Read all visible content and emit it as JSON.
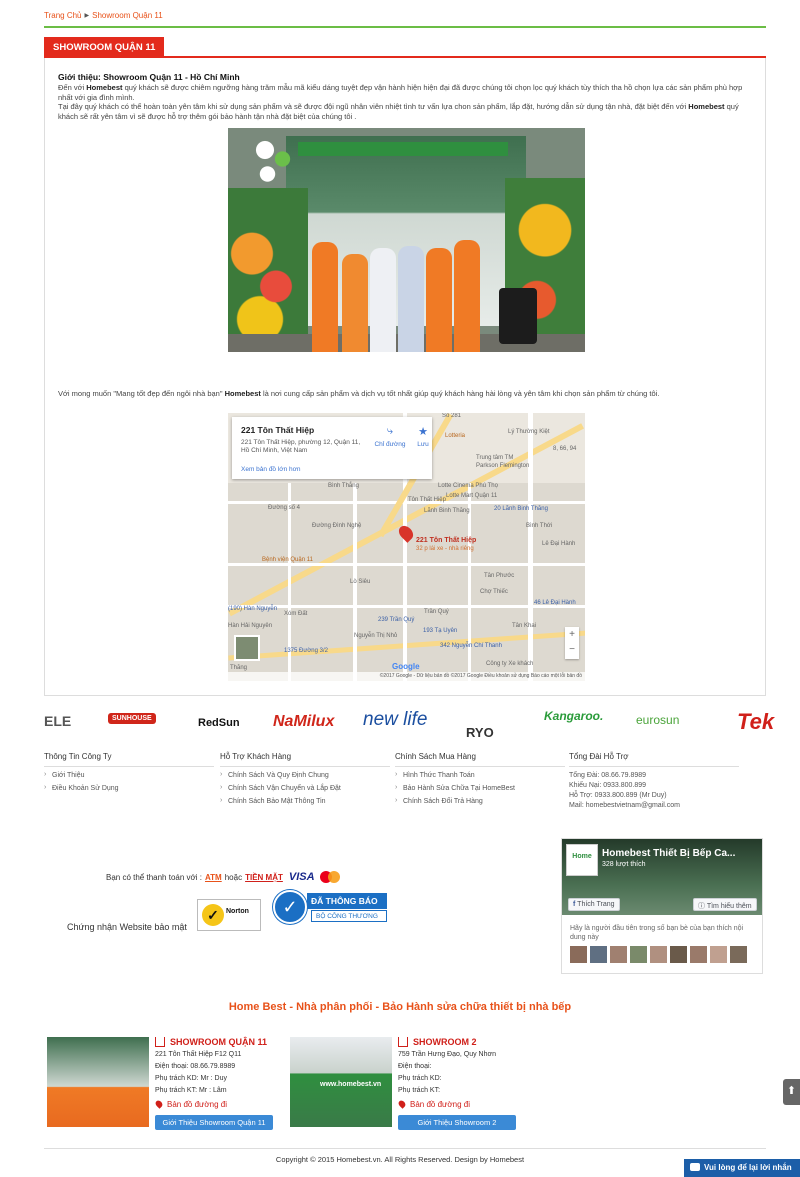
{
  "breadcrumb": {
    "home": "Trang Chủ",
    "current": "Showroom Quận 11"
  },
  "section": {
    "title": "SHOWROOM QUẬN 11"
  },
  "intro": {
    "title": "Giới thiệu: Showroom Quận 11 - Hồ Chí Minh",
    "p1_a": "Đến với ",
    "p1_brand": "Homebest",
    "p1_b": "  quý khách sẽ được chiêm ngưỡng hàng trăm mẫu mã kiểu dáng tuyệt đẹp vận hành hiện hiện đại đã được chúng tôi chọn lọc quý khách tùy thích tha hồ chọn lựa các sản phẩm phù hợp nhất với gia đình mình.",
    "p2_a": "Tại đây quý khách có thể hoàn toàn yên tâm khi sử dụng sản phẩm và sẽ được đội ngũ nhân viên nhiệt tình tư vấn lựa chon sản phẩm, lắp đặt, hướng dẫn sử dụng tận nhà, đặt biệt đến với ",
    "p2_brand": "Homebest",
    "p2_b": " quý khách sẽ rất yên tâm vì sẽ được hỗ trợ thêm gói bảo hành tận nhà đặt biệt của chúng tôi .",
    "mission_a": "Với mong muốn \"Mang tốt đẹp đến ngôi nhà bạn\" ",
    "mission_brand": "Homebest",
    "mission_b": "  là nơi cung cấp sản phẩm và dịch vụ tốt nhất giúp quý khách hàng hài lòng và yên tâm khi chọn sản phẩm từ chúng tôi."
  },
  "map": {
    "place_title": "221 Tôn Thất Hiệp",
    "place_address": "221 Tôn Thất Hiệp, phường 12, Quận 11, Hồ Chí Minh, Việt Nam",
    "directions": "Chỉ đường",
    "save": "Lưu",
    "larger_map": "Xem bản đồ lớn hơn",
    "pin_label": "221 Tôn Thất Hiệp",
    "pin_sub": "32 p lái xe - nhà riêng",
    "attribution": "©2017 Google - Dữ liệu bản đồ ©2017 Google    Điều khoản sử dụng    Báo cáo một lỗi bản đồ",
    "labels": {
      "lotteria": "Lotteria",
      "trung_tam": "Trung tâm TM",
      "parkson": "Parkson Flemington",
      "cinema": "Lotte Cinema Phú Thọ",
      "lotte_mart": "Lotte Mart Quận 11",
      "lanh_binh_thang": "20 Lãnh Binh Thăng",
      "benh_vien": "Bệnh viện Quận 11",
      "cho_thiec": "Chợ Thiếc",
      "le_dai_hanh": "46 Lê Đại Hành",
      "tran_quy": "239 Trần Quý",
      "ta_uyen": "193 Tạ Uyên",
      "nguyen_chi_thanh": "342 Nguyễn Chí Thanh",
      "duong_3_2": "1375 Đường 3/2",
      "han_nguyen": "(190) Hàn Nguyễn",
      "xe_khach": "Công ty Xe khách",
      "ly_thuong_kiet": "Lý Thường Kiệt",
      "so_281": "Số 281",
      "phone": "8, 66, 94",
      "duong_so_4": "Đường số 4",
      "duong_dinh_nghe": "Đường Đình Nghệ",
      "binh_thang": "Bình Thắng",
      "lanh_binh_thang_st": "Lãnh Binh Thăng",
      "ton_that_hiep": "Tôn Thất Hiệp",
      "lo_sieu": "Lò Siêu",
      "xom_dat": "Xóm Đất",
      "hai_nguyen": "Hàn Hải Nguyên",
      "nguyen_thi_nho": "Nguyễn Thị Nhỏ",
      "binh_thoi": "Bình Thới",
      "tan_phuoc": "Tân Phước",
      "le_dai_hanh_st": "Lê Đại Hành",
      "tran_quy_st": "Trần Quý",
      "tan_khai": "Tân Khai",
      "thang": "Thăng"
    }
  },
  "partners": [
    "ELE",
    "SUNHOUSE",
    "RedSun",
    "NaMilux",
    "new life",
    "RYO",
    "Kangaroo.",
    "eurosun",
    "Tek"
  ],
  "footer": {
    "col1": {
      "title": "Thông Tin Công Ty",
      "items": [
        "Giới Thiệu",
        "Điều Khoản Sử Dụng"
      ]
    },
    "col2": {
      "title": "Hỗ Trợ Khách Hàng",
      "items": [
        "Chính Sách Và Quy Định Chung",
        "Chính Sách Vận Chuyển và Lắp Đặt",
        "Chính Sách Bảo Mật Thông Tin"
      ]
    },
    "col3": {
      "title": "Chính Sách Mua Hàng",
      "items": [
        "Hình Thức Thanh Toán",
        "Bảo Hành Sửa Chữa Tại HomeBest",
        "Chính Sách Đổi Trả Hàng"
      ]
    },
    "col4": {
      "title": "Tổng Đài Hỗ Trợ",
      "lines": [
        "Tổng Đài: 08.66.79.8989",
        "Khiếu Nại: 0933.800.899",
        "Hỗ Trợ: 0933.800.899 (Mr Duy)",
        "Mail: homebestvietnam@gmail.com"
      ]
    }
  },
  "payment": {
    "text": "Bạn có thể thanh toán với : ",
    "atm": "ATM",
    "or": "hoặc",
    "cash": "TIỀN MẶT",
    "visa": "VISA",
    "cert_label": "Chứng nhận Website bảo mật",
    "norton": "Norton",
    "bct_line1": "ĐÃ THÔNG BÁO",
    "bct_line2": "BỘ CÔNG THƯƠNG"
  },
  "facebook": {
    "page_name": "Homebest Thiết Bị Bếp Ca...",
    "likes": "328 lượt thích",
    "avatar_text": "Home",
    "like_btn": "Thích Trang",
    "more_btn": "Tìm hiểu thêm",
    "note": "Hãy là người đầu tiên trong số bạn bè của bạn thích nội dung này"
  },
  "showroom_footer": {
    "title": "Home Best - Nhà phân phối - Bảo Hành sửa chữa thiết bị nhà bếp",
    "s1": {
      "name": "SHOWROOM QUẬN 11",
      "address": "221 Tôn Thất Hiệp F12 Q11",
      "phone": "Điện thoại: 08.66.79.8989",
      "kd": "Phụ trách KD: Mr : Duy",
      "kt": "Phụ trách KT: Mr : Lâm",
      "map": "Bản đồ đường đi",
      "button": "Giới Thiệu Showroom Quận 11"
    },
    "s2": {
      "name": "SHOWROOM 2",
      "address": "759 Trần Hưng Đạo, Quy Nhơn",
      "phone": "Điện thoại:",
      "kd": "Phụ trách KD:",
      "kt": "Phụ trách KT:",
      "map": "Bản đồ đường đi",
      "button": "Giới Thiệu Showroom 2",
      "image_text": "www.homebest.vn"
    }
  },
  "copyright": "Copyright © 2015 Homebest.vn. All Rights Reserved. Design by Homebest",
  "chat": "Vui lòng để lại lời nhắn",
  "colors": {
    "accent": "#e32a1c",
    "orange": "#e8521a",
    "green": "#6bbd45",
    "blue": "#3b8ad6"
  }
}
